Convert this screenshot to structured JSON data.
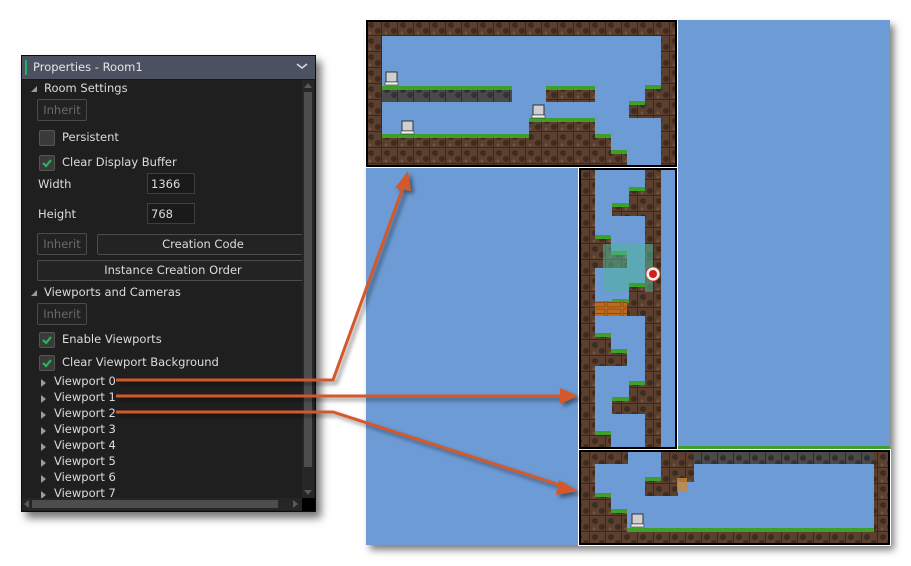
{
  "panel": {
    "title": "Properties - Room1",
    "collapse_icon": "chevron-down-icon",
    "accent_color": "#21b060",
    "room_settings": {
      "section_label": "Room Settings",
      "inherit_label": "Inherit",
      "persistent": {
        "label": "Persistent",
        "checked": false
      },
      "clear_display_buffer": {
        "label": "Clear Display Buffer",
        "checked": true
      },
      "width": {
        "label": "Width",
        "value": "1366"
      },
      "height": {
        "label": "Height",
        "value": "768"
      },
      "inherit2_label": "Inherit",
      "creation_code_label": "Creation Code",
      "instance_creation_order_label": "Instance Creation Order"
    },
    "viewports": {
      "section_label": "Viewports and Cameras",
      "inherit_label": "Inherit",
      "enable_viewports": {
        "label": "Enable Viewports",
        "checked": true
      },
      "clear_viewport_background": {
        "label": "Clear Viewport Background",
        "checked": true
      },
      "items": [
        {
          "label": "Viewport 0"
        },
        {
          "label": "Viewport 1"
        },
        {
          "label": "Viewport 2"
        },
        {
          "label": "Viewport 3"
        },
        {
          "label": "Viewport 4"
        },
        {
          "label": "Viewport 5"
        },
        {
          "label": "Viewport 6"
        },
        {
          "label": "Viewport 7"
        }
      ]
    }
  },
  "room": {
    "background_color": "#6d9bd5",
    "viewport_regions": [
      "viewport-0",
      "viewport-1",
      "viewport-2"
    ]
  },
  "annotation": {
    "arrow_color": "#d4582a"
  }
}
